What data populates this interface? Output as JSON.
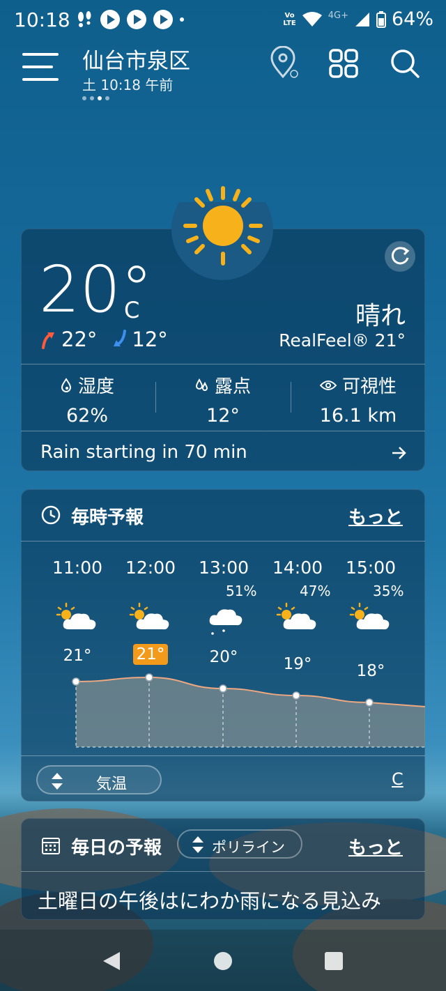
{
  "status_bar": {
    "time": "10:18",
    "volte": "Vo\nLTE",
    "network": "4G+",
    "battery": "64%"
  },
  "header": {
    "location": "仙台市泉区",
    "datetime": "土 10:18 午前"
  },
  "current": {
    "temp": "20°",
    "unit": "C",
    "high": "22°",
    "low": "12°",
    "condition": "晴れ",
    "realfeel": "RealFeel® 21°",
    "humidity_label": "湿度",
    "humidity": "62%",
    "dewpoint_label": "露点",
    "dewpoint": "12°",
    "visibility_label": "可視性",
    "visibility": "16.1 km",
    "rain_message": "Rain starting in 70 min"
  },
  "hourly": {
    "title": "毎時予報",
    "more": "もっと",
    "hours": [
      {
        "time": "11:00",
        "precip": "",
        "temp": "21°",
        "icon": "partly-sunny-icon"
      },
      {
        "time": "12:00",
        "precip": "",
        "temp": "21°",
        "icon": "partly-sunny-icon"
      },
      {
        "time": "13:00",
        "precip": "51%",
        "temp": "20°",
        "icon": "light-rain-icon"
      },
      {
        "time": "14:00",
        "precip": "47%",
        "temp": "19°",
        "icon": "partly-sunny-icon"
      },
      {
        "time": "15:00",
        "precip": "35%",
        "temp": "18°",
        "icon": "partly-sunny-icon"
      }
    ],
    "selector_label": "気温",
    "unit_link": "C"
  },
  "daily": {
    "title": "毎日の予報",
    "view_selector": "ポリライン",
    "more": "もっと",
    "summary": "土曜日の午後はにわか雨になる見込み"
  },
  "colors": {
    "accent_orange": "#f39a1b",
    "sun_yellow": "#f7b21b",
    "high_arrow": "#ff5a3c",
    "low_arrow": "#3d8ff0"
  }
}
